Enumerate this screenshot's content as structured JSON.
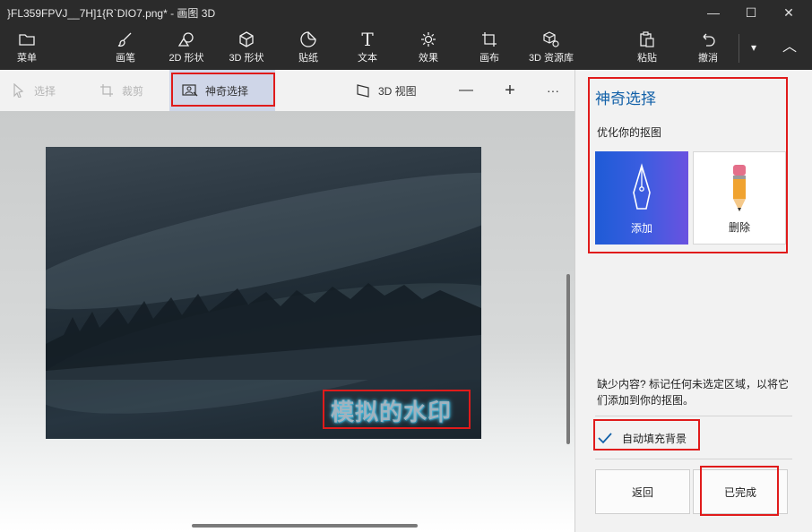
{
  "window": {
    "title": "}FL359FPVJ__7H]1{R`DIO7.png* - 画图 3D",
    "minimize_glyph": "—",
    "maximize_glyph": "☐",
    "close_glyph": "✕"
  },
  "ribbon": {
    "items": [
      {
        "label": "菜单",
        "icon": "folder-icon"
      },
      {
        "label": "画笔",
        "icon": "brush-icon"
      },
      {
        "label": "2D 形状",
        "icon": "2d-shapes-icon"
      },
      {
        "label": "3D 形状",
        "icon": "3d-cube-icon"
      },
      {
        "label": "贴纸",
        "icon": "sticker-icon"
      },
      {
        "label": "文本",
        "icon": "text-icon"
      },
      {
        "label": "效果",
        "icon": "sun-effects-icon"
      },
      {
        "label": "画布",
        "icon": "canvas-crop-icon"
      },
      {
        "label": "3D 资源库",
        "icon": "3d-library-icon"
      },
      {
        "label": "粘贴",
        "icon": "paste-icon"
      },
      {
        "label": "撤消",
        "icon": "undo-icon"
      }
    ],
    "more_glyph": "▾",
    "collapse_glyph": "︿"
  },
  "subbar": {
    "select_label": "选择",
    "crop_label": "裁剪",
    "magic_select_label": "神奇选择",
    "view3d_label": "3D 视图",
    "zoom_out_glyph": "—",
    "zoom_in_glyph": "+",
    "more_glyph": "···"
  },
  "canvas": {
    "watermark_text": "模拟的水印"
  },
  "panel": {
    "title": "神奇选择",
    "subtitle": "优化你的抠图",
    "add_label": "添加",
    "delete_label": "删除",
    "hint": "缺少内容? 标记任何未选定区域，以将它们添加到你的抠图。",
    "autofill_label": "自动填充背景",
    "back_label": "返回",
    "done_label": "已完成"
  },
  "colors": {
    "accent": "#1160a8",
    "highlight_red": "#e01b1b",
    "ribbon_bg": "#2b2b2b"
  }
}
